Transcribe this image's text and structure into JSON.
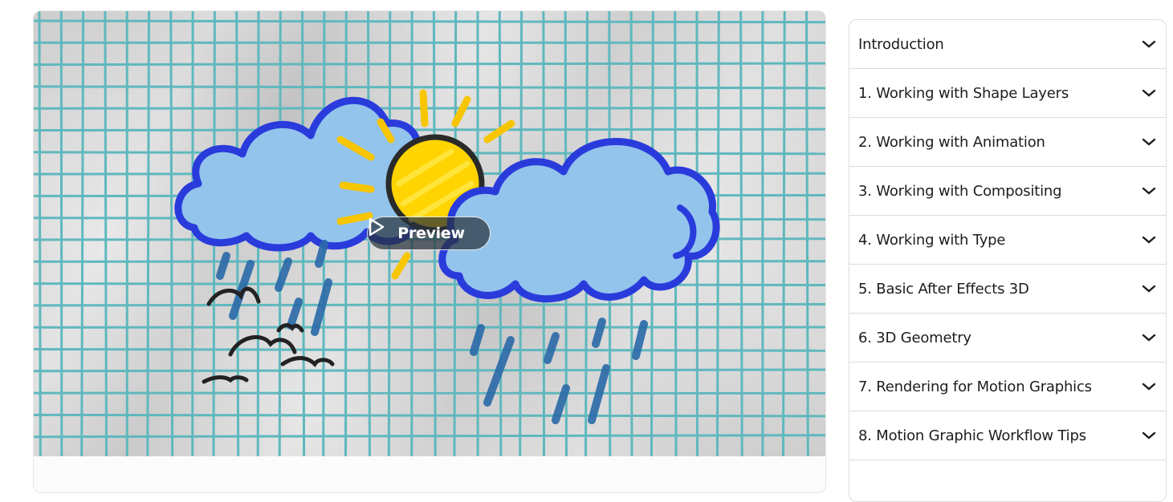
{
  "video": {
    "thumbnail_alt": "Hand-drawn weather doodle: clouds, sun, rain and birds on grid paper",
    "preview_button": {
      "label": "Preview",
      "icon": "play-icon"
    }
  },
  "colors": {
    "grid_line": "#5fb8be",
    "cloud_fill": "#93c4ec",
    "cloud_outline": "#2a3bdc",
    "sun_fill": "#ffd400",
    "sun_outline": "#2a2a2a",
    "rain": "#2a6aa8",
    "bird": "#222222",
    "border": "#dcdcdc",
    "text": "#1c1d1f"
  },
  "curriculum": {
    "sections": [
      {
        "title": "Introduction",
        "icon": "chevron-down-icon"
      },
      {
        "title": "1. Working with Shape Layers",
        "icon": "chevron-down-icon"
      },
      {
        "title": "2. Working with Animation",
        "icon": "chevron-down-icon"
      },
      {
        "title": "3. Working with Compositing",
        "icon": "chevron-down-icon"
      },
      {
        "title": "4. Working with Type",
        "icon": "chevron-down-icon"
      },
      {
        "title": "5. Basic After Effects 3D",
        "icon": "chevron-down-icon"
      },
      {
        "title": "6. 3D Geometry",
        "icon": "chevron-down-icon"
      },
      {
        "title": "7. Rendering for Motion Graphics",
        "icon": "chevron-down-icon"
      },
      {
        "title": "8. Motion Graphic Workflow Tips",
        "icon": "chevron-down-icon"
      }
    ]
  }
}
